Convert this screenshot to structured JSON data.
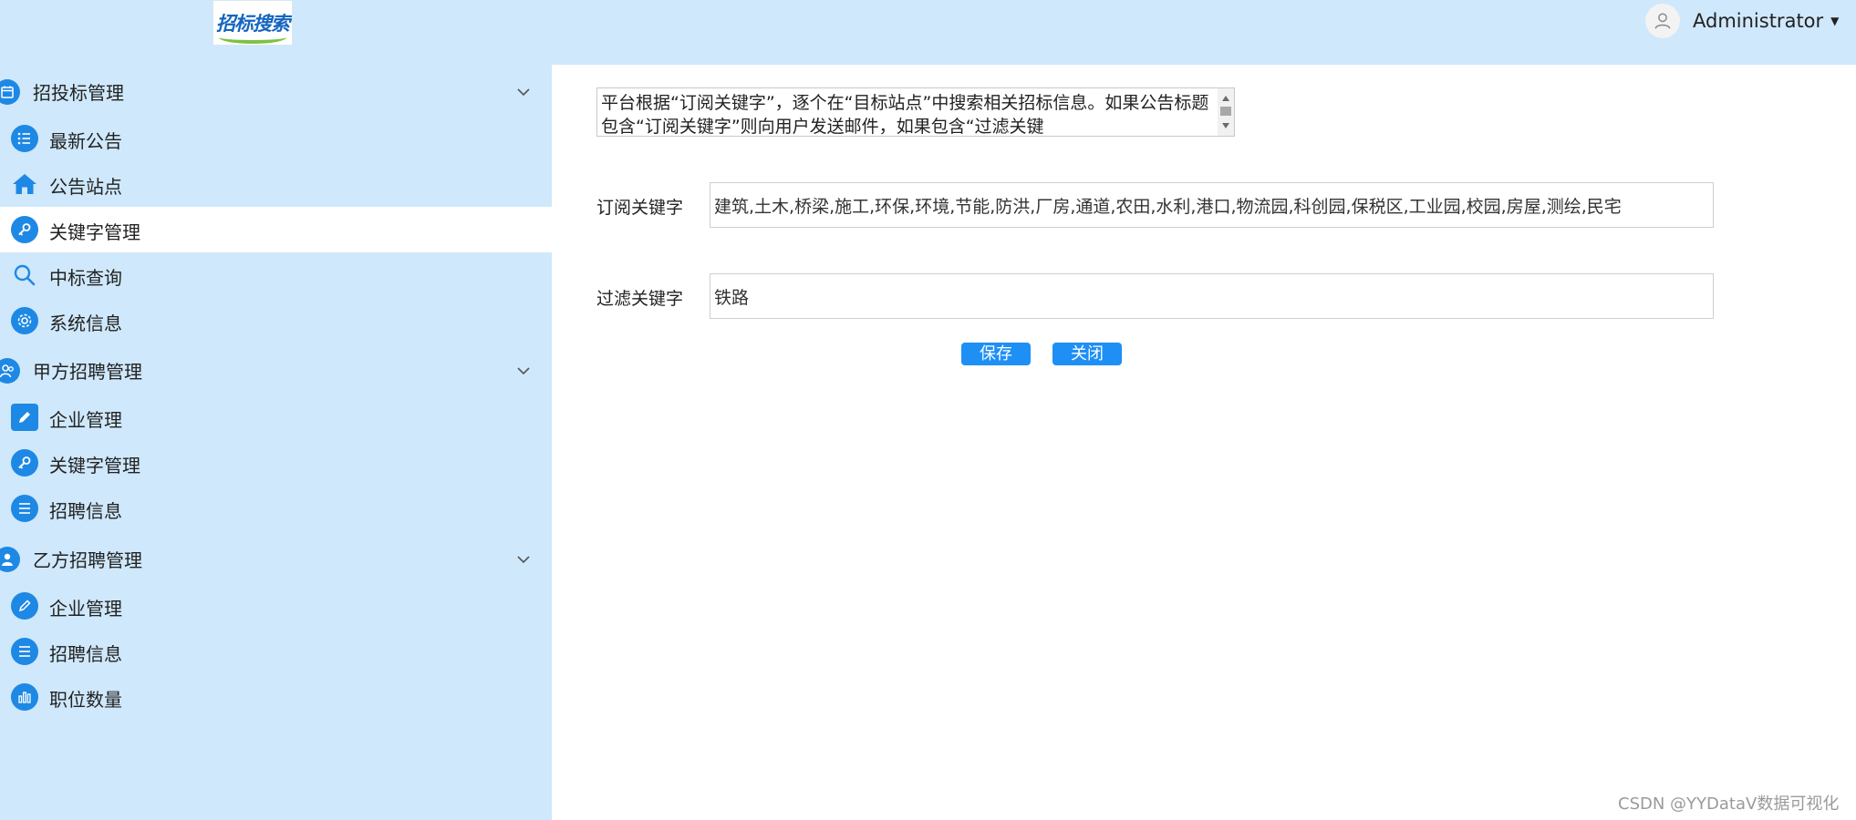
{
  "header": {
    "logo_text": "招标搜索",
    "user_name": "Administrator"
  },
  "sidebar": {
    "groups": [
      {
        "label": "招投标管理",
        "items": [
          {
            "label": "最新公告"
          },
          {
            "label": "公告站点"
          },
          {
            "label": "关键字管理",
            "active": true
          },
          {
            "label": "中标查询"
          },
          {
            "label": "系统信息"
          }
        ]
      },
      {
        "label": "甲方招聘管理",
        "items": [
          {
            "label": "企业管理"
          },
          {
            "label": "关键字管理"
          },
          {
            "label": "招聘信息"
          }
        ]
      },
      {
        "label": "乙方招聘管理",
        "items": [
          {
            "label": "企业管理"
          },
          {
            "label": "招聘信息"
          },
          {
            "label": "职位数量"
          }
        ]
      }
    ]
  },
  "main": {
    "description": "平台根据“订阅关键字”，逐个在“目标站点”中搜索相关招标信息。如果公告标题包含“订阅关键字”则向用户发送邮件，如果包含“过滤关键",
    "subscribe_label": "订阅关键字",
    "subscribe_value": "建筑,土木,桥梁,施工,环保,环境,节能,防洪,厂房,通道,农田,水利,港口,物流园,科创园,保税区,工业园,校园,房屋,测绘,民宅",
    "filter_label": "过滤关键字",
    "filter_value": "铁路",
    "save_label": "保存",
    "close_label": "关闭"
  },
  "watermark": "CSDN @YYDataV数据可视化",
  "colors": {
    "sidebar_bg": "#cfe8fb",
    "accent": "#1e88e5",
    "button": "#1e8ff5"
  }
}
